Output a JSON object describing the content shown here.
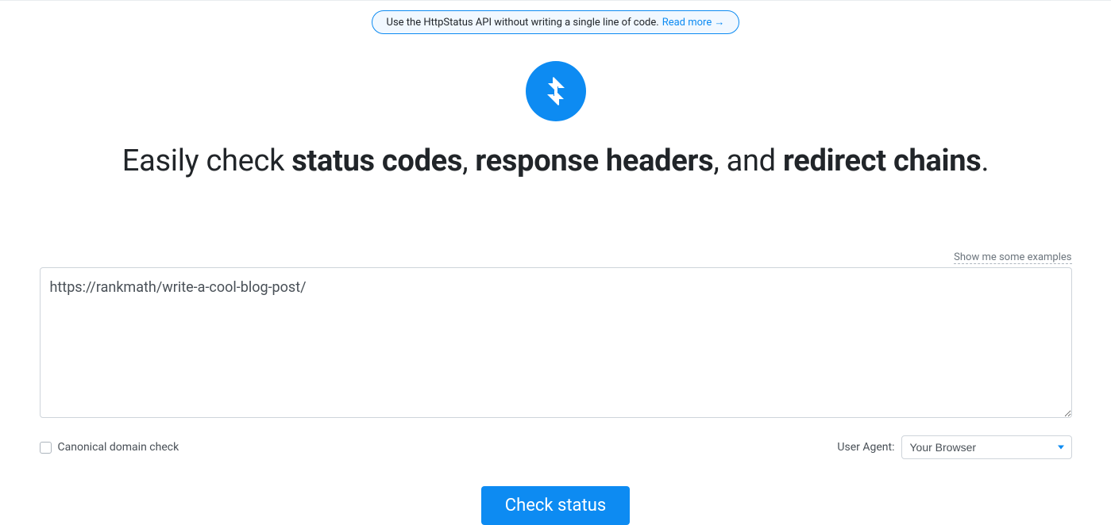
{
  "promo": {
    "text": "Use the HttpStatus API without writing a single line of code. ",
    "link_text": "Read more →"
  },
  "headline": {
    "pre1": "Easily check ",
    "b1": "status codes",
    "mid1": ", ",
    "b2": "response headers",
    "mid2": ", and ",
    "b3": "redirect chains",
    "post": "."
  },
  "examples_link": "Show me some examples",
  "url_input": {
    "value": "https://rankmath/write-a-cool-blog-post/"
  },
  "canonical_label": "Canonical domain check",
  "user_agent": {
    "label": "User Agent:",
    "selected": "Your Browser"
  },
  "submit_label": "Check status",
  "colors": {
    "accent": "#0d8bf2"
  }
}
